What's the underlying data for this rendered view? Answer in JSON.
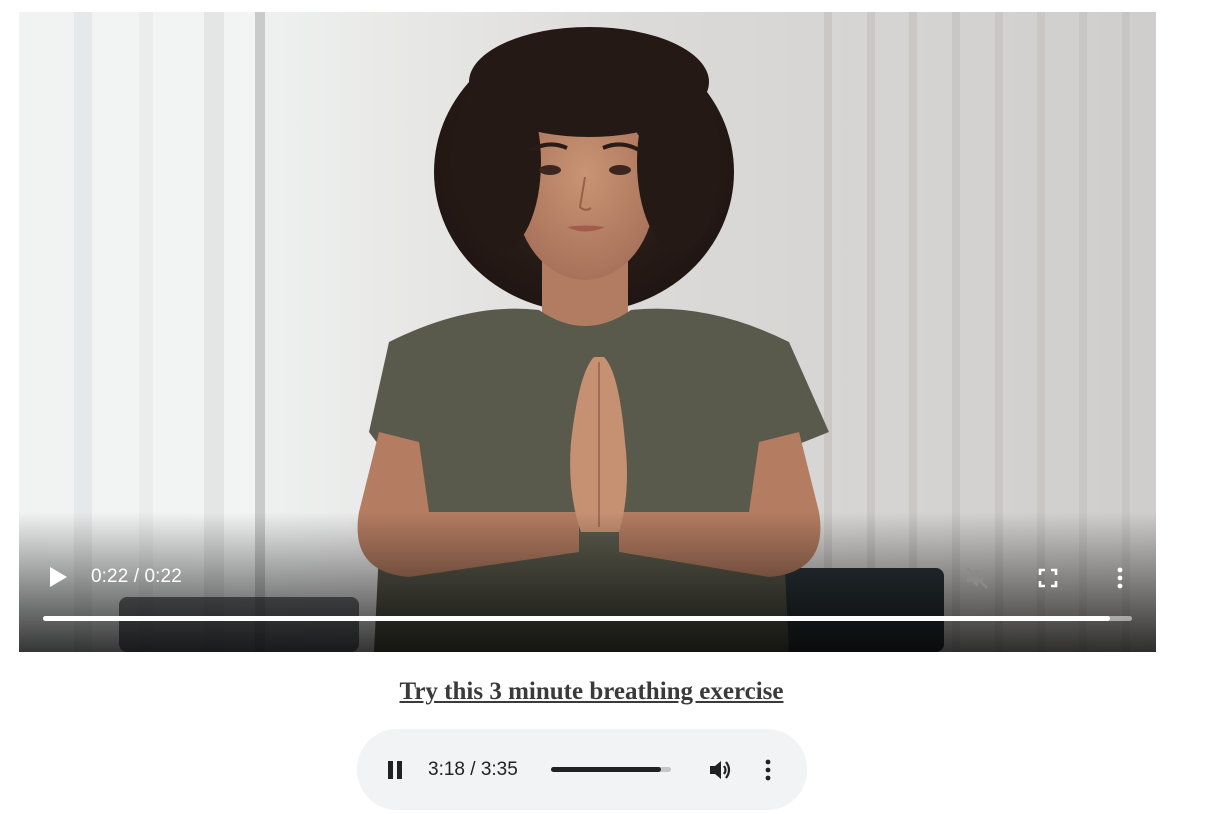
{
  "video": {
    "current_time": "0:22",
    "duration": "0:22",
    "time_display": "0:22 / 0:22",
    "progress_fraction": 0.98,
    "muted": true,
    "icons": {
      "play": "play-icon",
      "mute": "volume-muted-icon",
      "fullscreen": "fullscreen-icon",
      "more": "more-options-icon"
    }
  },
  "caption": {
    "link_text": "Try this 3 minute breathing exercise"
  },
  "audio": {
    "current_time": "3:18",
    "duration": "3:35",
    "time_display": "3:18 / 3:35",
    "progress_fraction": 0.92,
    "state": "playing",
    "icons": {
      "pause": "pause-icon",
      "volume": "volume-icon",
      "more": "more-options-icon"
    }
  },
  "colors": {
    "audio_background": "#f1f3f4",
    "caption_text": "#3a3a3a",
    "video_controls_foreground": "#ffffff"
  }
}
